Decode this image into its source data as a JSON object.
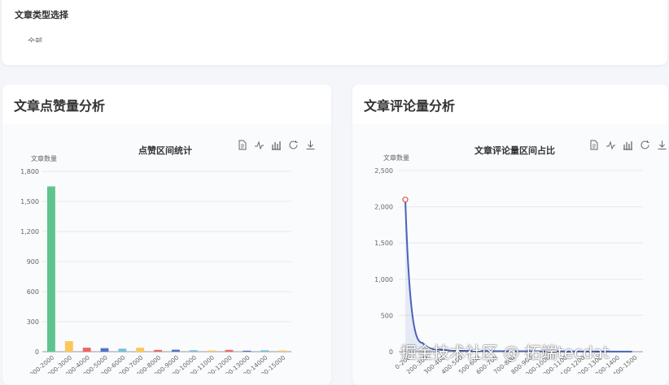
{
  "filter": {
    "title": "文章类型选择",
    "selected": "全部"
  },
  "left_panel": {
    "title": "文章点赞量分析"
  },
  "right_panel": {
    "title": "文章评论量分析"
  },
  "toolbox_icons": [
    "data-view-icon",
    "line-chart-icon",
    "bar-chart-icon",
    "restore-icon",
    "download-icon"
  ],
  "watermark": "掘金技术社区 @ 拓端tecdat",
  "chart_data": [
    {
      "type": "bar",
      "title": "点赞区间统计",
      "ylabel": "文章数量",
      "ylim": [
        0,
        1800
      ],
      "yticks": [
        "0",
        "300",
        "600",
        "900",
        "1,200",
        "1,500",
        "1,800"
      ],
      "categories": [
        "1000-2000",
        "2000-3000",
        "3000-4000",
        "4000-5000",
        "5000-6000",
        "6000-7000",
        "7000-8000",
        "8000-9000",
        "9000-10000",
        "10000-11000",
        "11000-12000",
        "12000-13000",
        "13000-14000",
        "14000-15000"
      ],
      "values": [
        1650,
        105,
        40,
        35,
        30,
        40,
        18,
        20,
        15,
        12,
        18,
        10,
        14,
        12
      ],
      "colors": [
        "#5ec48e",
        "#fac858",
        "#ee6666",
        "#5470c6",
        "#73c0de",
        "#fac858",
        "#ee6666",
        "#5470c6",
        "#73c0de",
        "#fac858",
        "#ee6666",
        "#5470c6",
        "#73c0de",
        "#fac858"
      ]
    },
    {
      "type": "line",
      "title": "文章评论量区间占比",
      "ylabel": "文章数量",
      "ylim": [
        0,
        2500
      ],
      "yticks": [
        "0",
        "500",
        "1,000",
        "1,500",
        "2,000",
        "2,500"
      ],
      "categories": [
        "0-200",
        "200-300",
        "300-400",
        "400-500",
        "500-600",
        "600-700",
        "700-800",
        "800-900",
        "900-1000",
        "1000-1100",
        "1100-1200",
        "1200-1300",
        "1300-1400",
        "1400-1500"
      ],
      "values": [
        2100,
        120,
        30,
        15,
        10,
        8,
        6,
        5,
        4,
        3,
        3,
        2,
        2,
        2
      ],
      "color": "#4a62b8"
    }
  ]
}
